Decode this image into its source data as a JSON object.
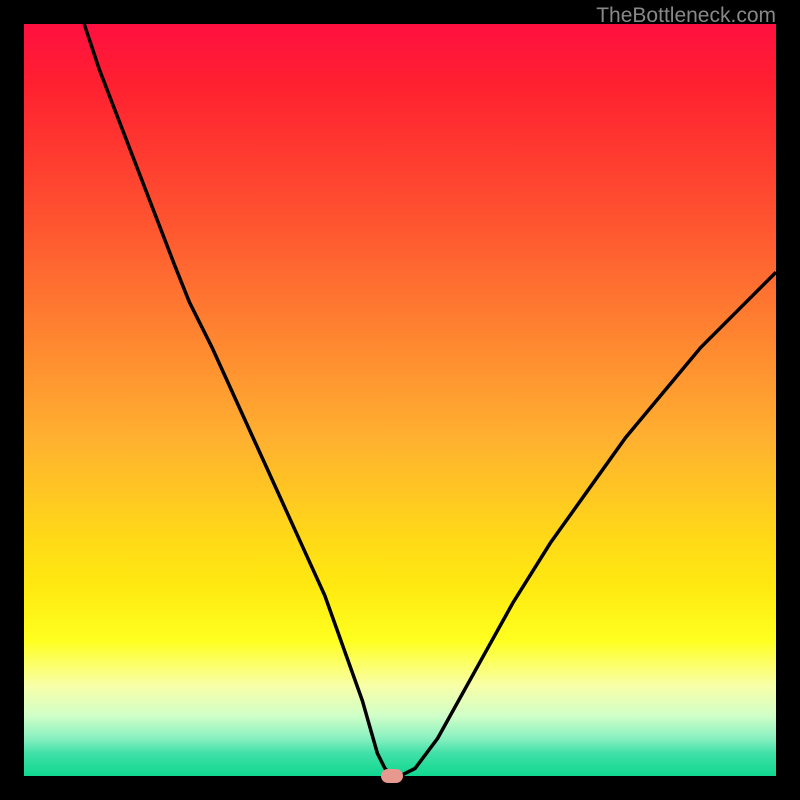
{
  "attribution": "TheBottleneck.com",
  "chart_data": {
    "type": "line",
    "title": "",
    "xlabel": "",
    "ylabel": "",
    "xlim": [
      0,
      100
    ],
    "ylim": [
      0,
      100
    ],
    "series": [
      {
        "name": "bottleneck-curve",
        "x": [
          8,
          10,
          15,
          20,
          22,
          25,
          30,
          35,
          40,
          45,
          47,
          48,
          49,
          50,
          52,
          55,
          60,
          65,
          70,
          75,
          80,
          85,
          90,
          95,
          100
        ],
        "values": [
          100,
          94,
          81,
          68,
          63,
          57,
          46,
          35,
          24,
          10,
          3,
          1,
          0,
          0,
          1,
          5,
          14,
          23,
          31,
          38,
          45,
          51,
          57,
          62,
          67
        ]
      }
    ],
    "marker": {
      "x": 49,
      "y": 0
    },
    "gradient_stops": [
      {
        "pos": 0,
        "color": "#ff1040"
      },
      {
        "pos": 25,
        "color": "#ff5030"
      },
      {
        "pos": 55,
        "color": "#ffb030"
      },
      {
        "pos": 75,
        "color": "#ffea10"
      },
      {
        "pos": 90,
        "color": "#e0ffc0"
      },
      {
        "pos": 100,
        "color": "#10d890"
      }
    ]
  }
}
